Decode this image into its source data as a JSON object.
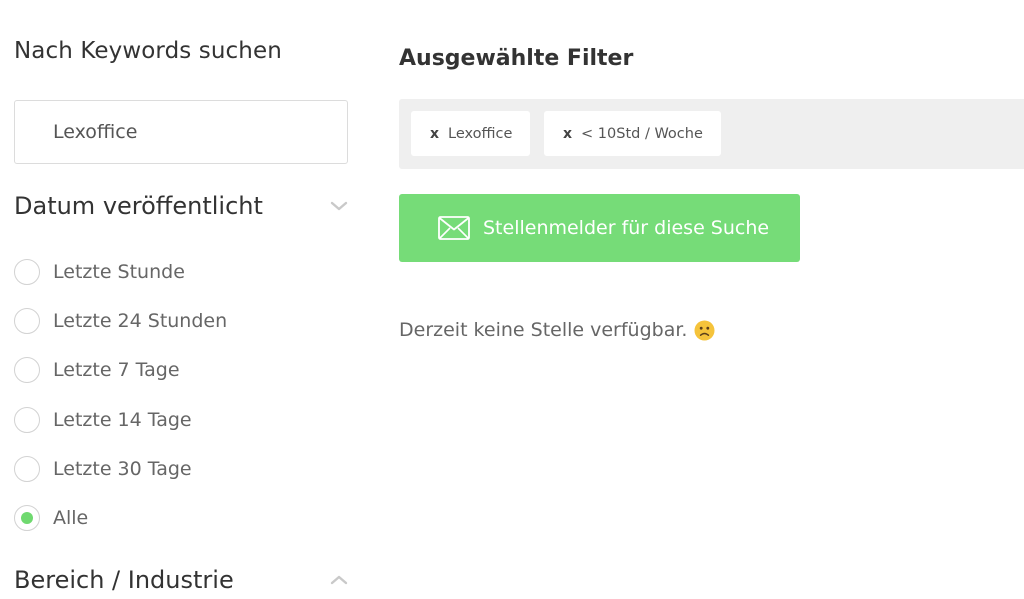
{
  "sidebar": {
    "keyword_title": "Nach Keywords suchen",
    "keyword_input_value": "Lexoffice",
    "date_section_title": "Datum veröffentlicht",
    "date_options": [
      {
        "label": "Letzte Stunde",
        "selected": false
      },
      {
        "label": "Letzte 24 Stunden",
        "selected": false
      },
      {
        "label": "Letzte 7 Tage",
        "selected": false
      },
      {
        "label": "Letzte 14 Tage",
        "selected": false
      },
      {
        "label": "Letzte 30 Tage",
        "selected": false
      },
      {
        "label": "Alle",
        "selected": true
      }
    ],
    "industry_section_title": "Bereich / Industrie"
  },
  "main": {
    "filters_title": "Ausgewählte Filter",
    "filter_chips": [
      {
        "remove_label": "x",
        "label": "Lexoffice"
      },
      {
        "remove_label": "x",
        "label": "< 10Std / Woche"
      }
    ],
    "alert_button_label": "Stellenmelder für diese Suche",
    "empty_message": "Derzeit keine Stelle verfügbar."
  },
  "icons": {
    "date_chevron": "chevron-down-icon",
    "industry_chevron": "chevron-up-icon",
    "alert_button_icon": "envelope-icon",
    "empty_emoji": "sad-face-emoji-icon"
  },
  "colors": {
    "accent_green": "#76dc78",
    "radio_selected": "#6fd96f",
    "filter_bar_bg": "#efefef",
    "emoji_yellow": "#f5c33b"
  }
}
